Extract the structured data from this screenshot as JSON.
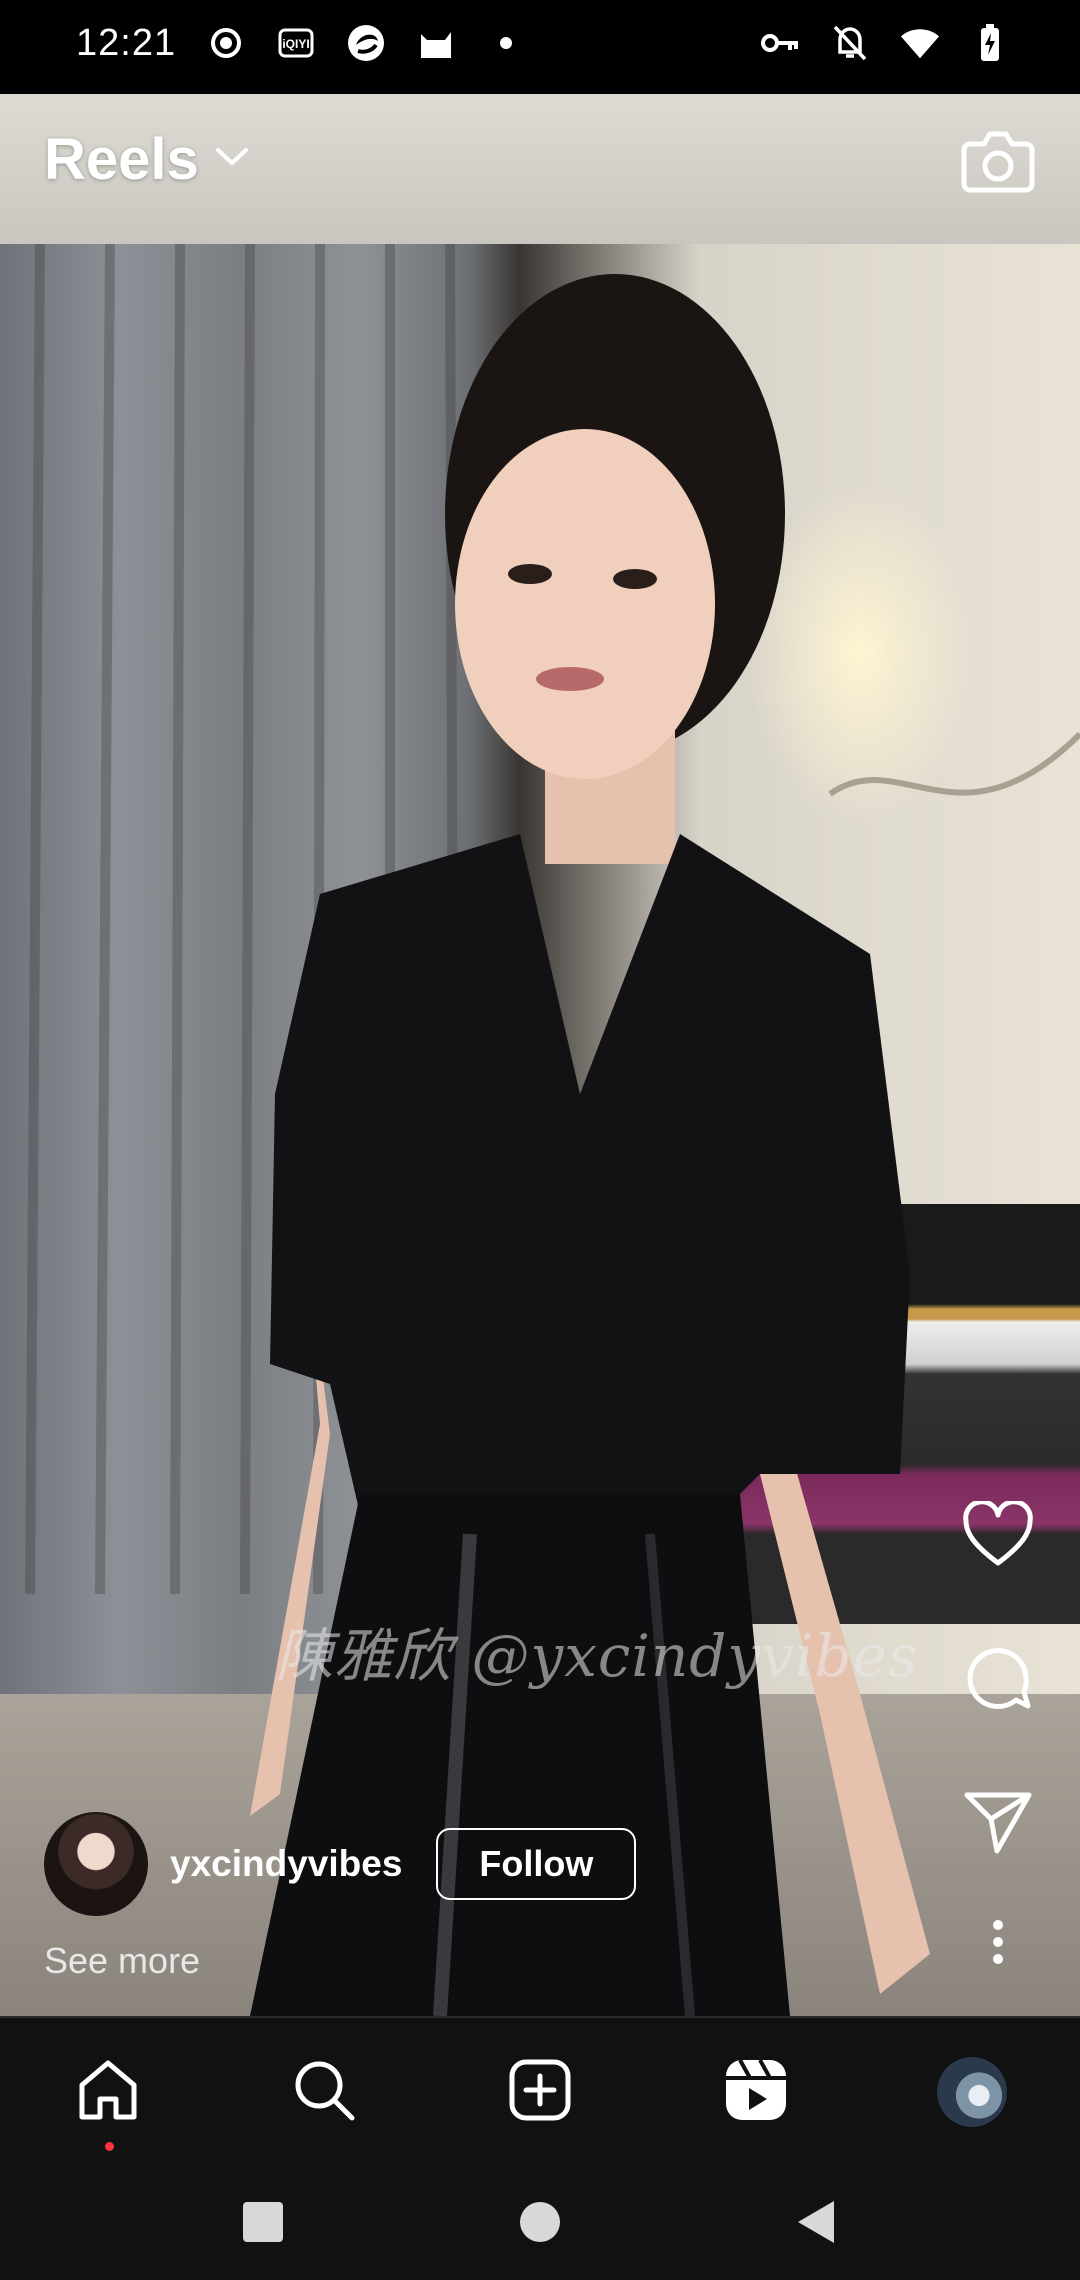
{
  "status_bar": {
    "time": "12:21",
    "left_icons": [
      "record-icon",
      "iqiyi-icon",
      "browser-icon",
      "cat-app-icon",
      "dot-icon"
    ],
    "right_icons": [
      "vpn-key-icon",
      "mute-bell-icon",
      "wifi-icon",
      "battery-charging-icon"
    ]
  },
  "header": {
    "title": "Reels",
    "dropdown_icon": "chevron-down-icon",
    "camera_icon": "camera-icon"
  },
  "video": {
    "watermark": "陳雅欣 @yxcindyvibes"
  },
  "actions": {
    "like_icon": "heart-icon",
    "comment_icon": "comment-icon",
    "share_icon": "send-icon",
    "more_icon": "more-vertical-icon"
  },
  "author": {
    "username": "yxcindyvibes",
    "follow_label": "Follow",
    "see_more_label": "See more"
  },
  "bottom_nav": {
    "items": [
      "home-icon",
      "search-icon",
      "create-icon",
      "reels-icon",
      "profile-avatar"
    ],
    "active": "reels",
    "notification_dot_color": "#ff3040"
  },
  "system_nav": [
    "recents-icon",
    "home-circle-icon",
    "back-icon"
  ]
}
